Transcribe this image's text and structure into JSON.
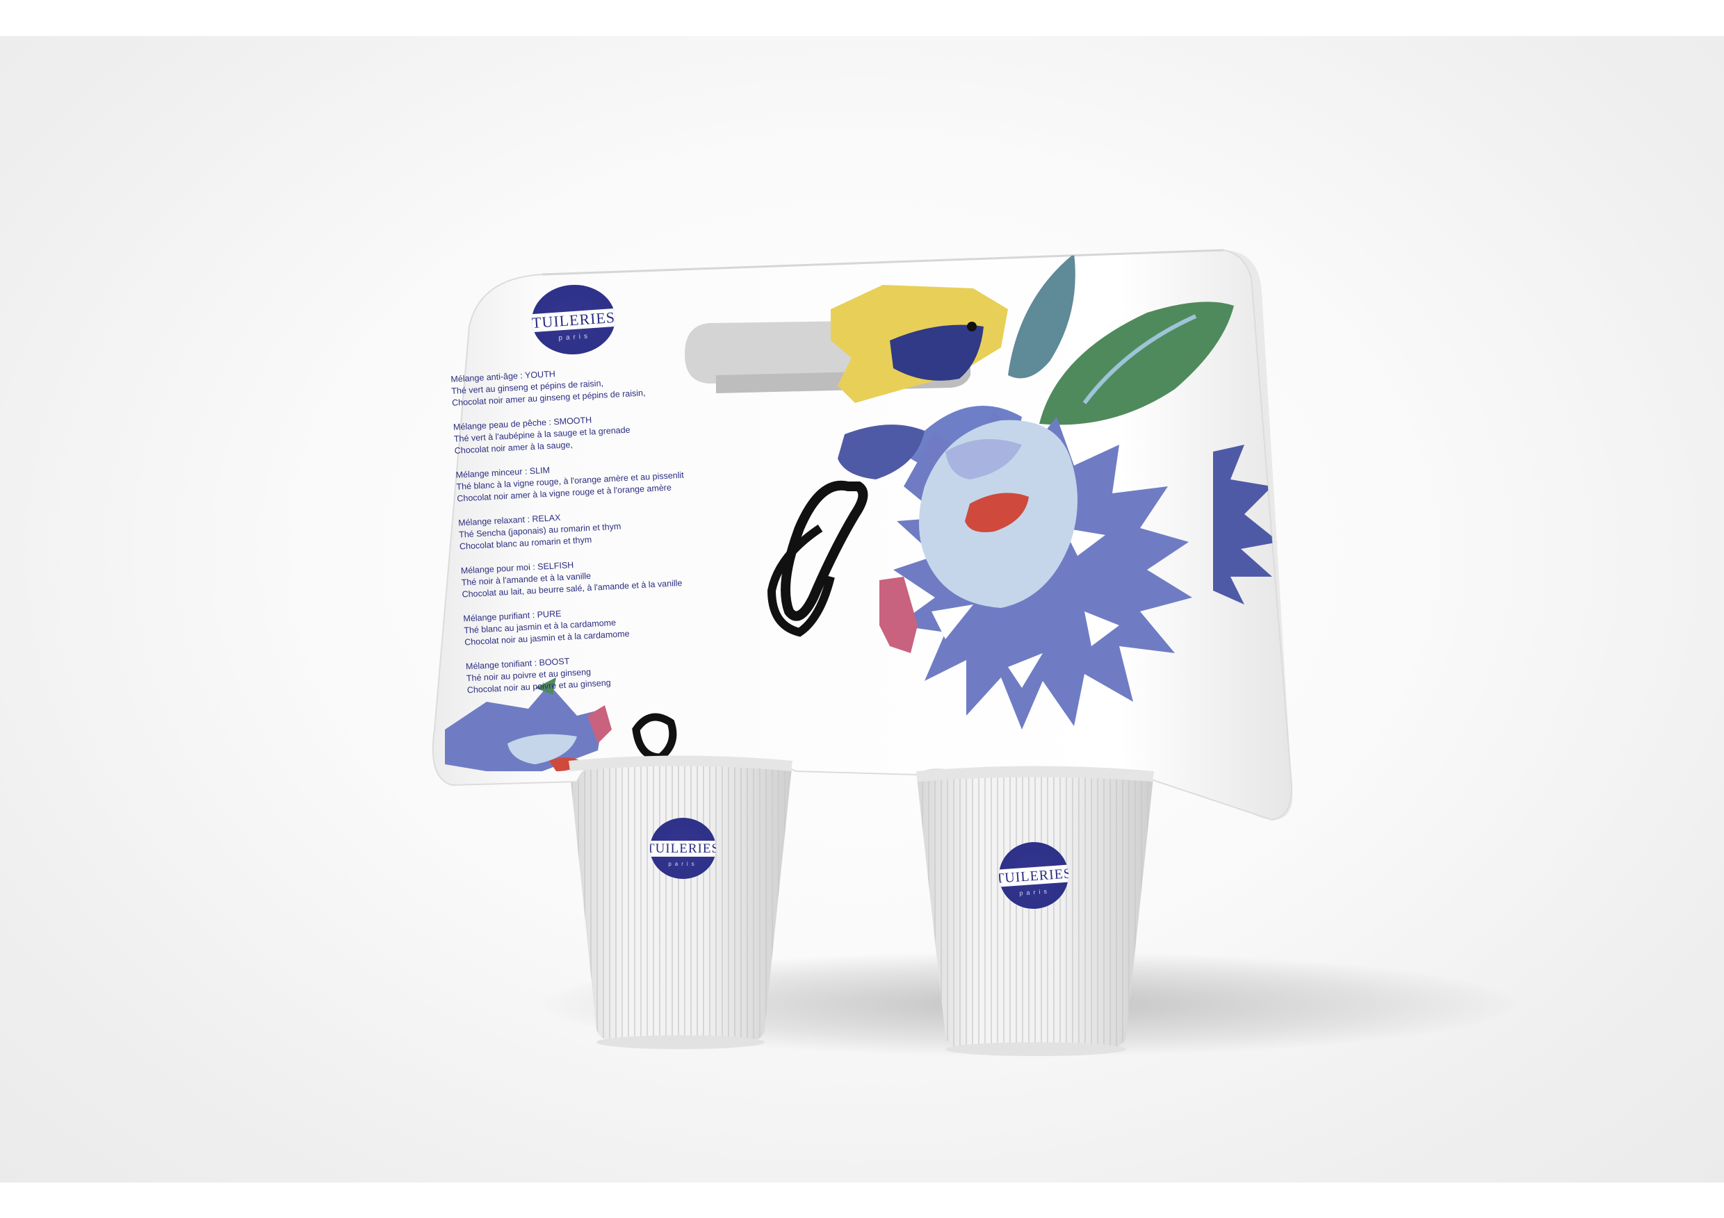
{
  "brand": {
    "name": "TUILERIES",
    "subline": "paris",
    "color": "#2c2f86"
  },
  "menu": [
    {
      "title": "Mélange anti-âge : YOUTH",
      "line1": "Thé vert au ginseng et pépins de raisin,",
      "line2": "Chocolat noir amer au ginseng et pépins de raisin,"
    },
    {
      "title": "Mélange peau de pêche : SMOOTH",
      "line1": "Thé vert à l'aubépine à la sauge et la grenade",
      "line2": "Chocolat noir amer à la sauge,"
    },
    {
      "title": "Mélange minceur : SLIM",
      "line1": "Thé blanc à la vigne rouge, à l'orange amère et au pissenlit",
      "line2": "Chocolat noir amer à la vigne rouge et à l'orange amère"
    },
    {
      "title": "Mélange relaxant : RELAX",
      "line1": "Thé Sencha (japonais) au romarin et thym",
      "line2": "Chocolat blanc au romarin et thym"
    },
    {
      "title": "Mélange pour moi : SELFISH",
      "line1": "Thé noir à l'amande et à la vanille",
      "line2": "Chocolat au lait, au beurre salé, à l'amande et à la vanille"
    },
    {
      "title": "Mélange purifiant : PURE",
      "line1": "Thé blanc au jasmin et à la cardamome",
      "line2": "Chocolat noir au jasmin et à la cardamome"
    },
    {
      "title": "Mélange tonifiant : BOOST",
      "line1": "Thé noir au poivre et au ginseng",
      "line2": "Chocolat noir au poivre et au ginseng"
    }
  ],
  "colors": {
    "background": "#efefef",
    "carrier": "#f7f7f7",
    "flower_blue": "#6f7cc4",
    "flower_light": "#c5d6ea",
    "leaf_green": "#4f8a5c",
    "leaf_teal": "#5f8a97",
    "accent_yellow": "#e8cf58",
    "accent_red": "#cf4a3c",
    "accent_pink": "#c9627e",
    "scribble": "#111111"
  }
}
